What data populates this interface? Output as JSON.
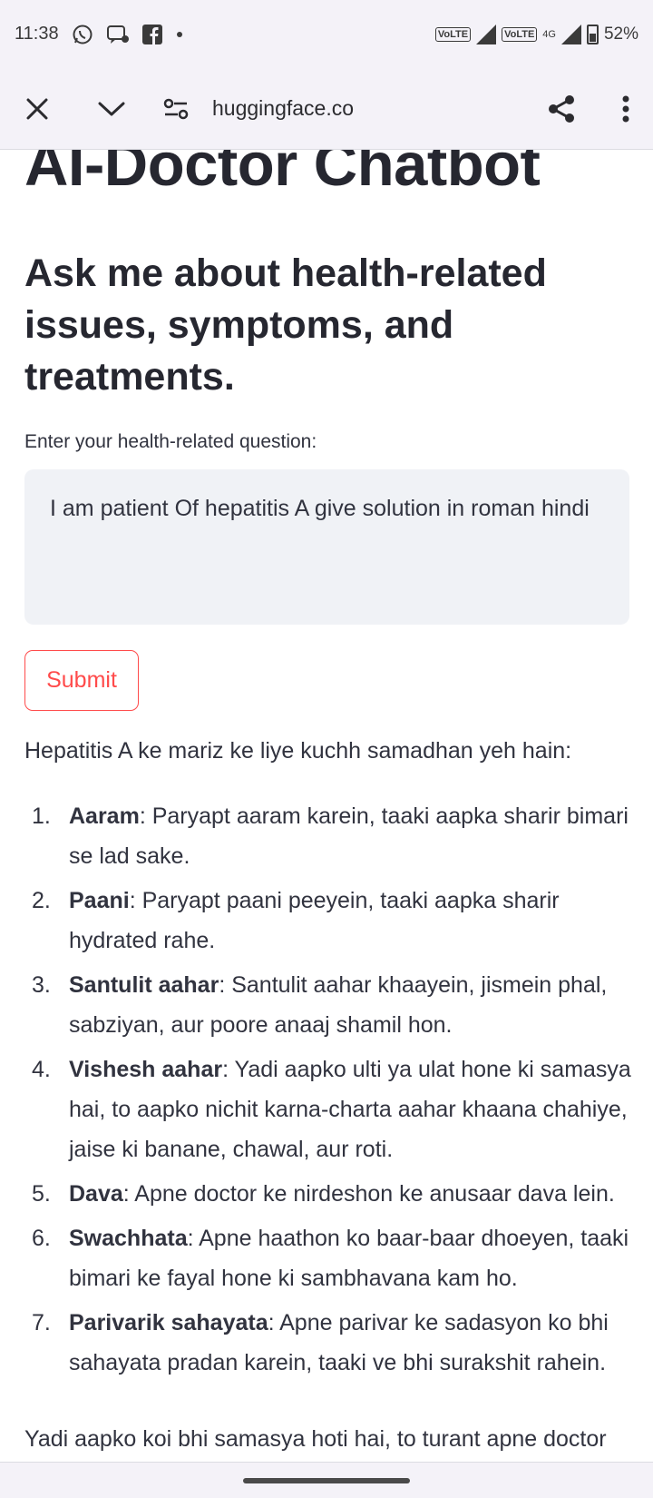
{
  "status_bar": {
    "time": "11:38",
    "battery": "52%",
    "network": "4G",
    "icons": [
      "whatsapp-icon",
      "message-icon",
      "facebook-icon",
      "dot-icon",
      "volte-icon",
      "signal-icon",
      "battery-icon"
    ]
  },
  "browser": {
    "url": "huggingface.co",
    "icons": [
      "close-icon",
      "chevron-down-icon",
      "site-settings-icon",
      "share-icon",
      "more-icon"
    ]
  },
  "page": {
    "title": "AI-Doctor Chatbot",
    "subtitle": "Ask me about health-related issues, symptoms, and treatments.",
    "input_label": "Enter your health-related question:",
    "input_value": "I am patient Of hepatitis A give solution in roman hindi",
    "submit_label": "Submit",
    "answer_intro": "Hepatitis A ke mariz ke liye kuchh samadhan yeh hain:",
    "answer_items": [
      {
        "num": "1.",
        "term": "Aaram",
        "text": ": Paryapt aaram karein, taaki aapka sharir bimari se lad sake."
      },
      {
        "num": "2.",
        "term": "Paani",
        "text": ": Paryapt paani peeyein, taaki aapka sharir hydrated rahe."
      },
      {
        "num": "3.",
        "term": "Santulit aahar",
        "text": ": Santulit aahar khaayein, jismein phal, sabziyan, aur poore anaaj shamil hon."
      },
      {
        "num": "4.",
        "term": "Vishesh aahar",
        "text": ": Yadi aapko ulti ya ulat hone ki samasya hai, to aapko nichit karna-charta aahar khaana chahiye, jaise ki banane, chawal, aur roti."
      },
      {
        "num": "5.",
        "term": "Dava",
        "text": ": Apne doctor ke nirdeshon ke anusaar dava lein."
      },
      {
        "num": "6.",
        "term": "Swachhata",
        "text": ": Apne haathon ko baar-baar dhoeyen, taaki bimari ke fayal hone ki sambhavana kam ho."
      },
      {
        "num": "7.",
        "term": "Parivarik sahayata",
        "text": ": Apne parivar ke sadasyon ko bhi sahayata pradan karein, taaki ve bhi surakshit rahein."
      }
    ],
    "answer_outro": "Yadi aapko koi bhi samasya hoti hai, to turant apne doctor"
  },
  "colors": {
    "accent": "#ff4b4b",
    "text": "#31333f",
    "input_bg": "#f0f2f6",
    "chrome_bg": "#f4f2f8"
  }
}
